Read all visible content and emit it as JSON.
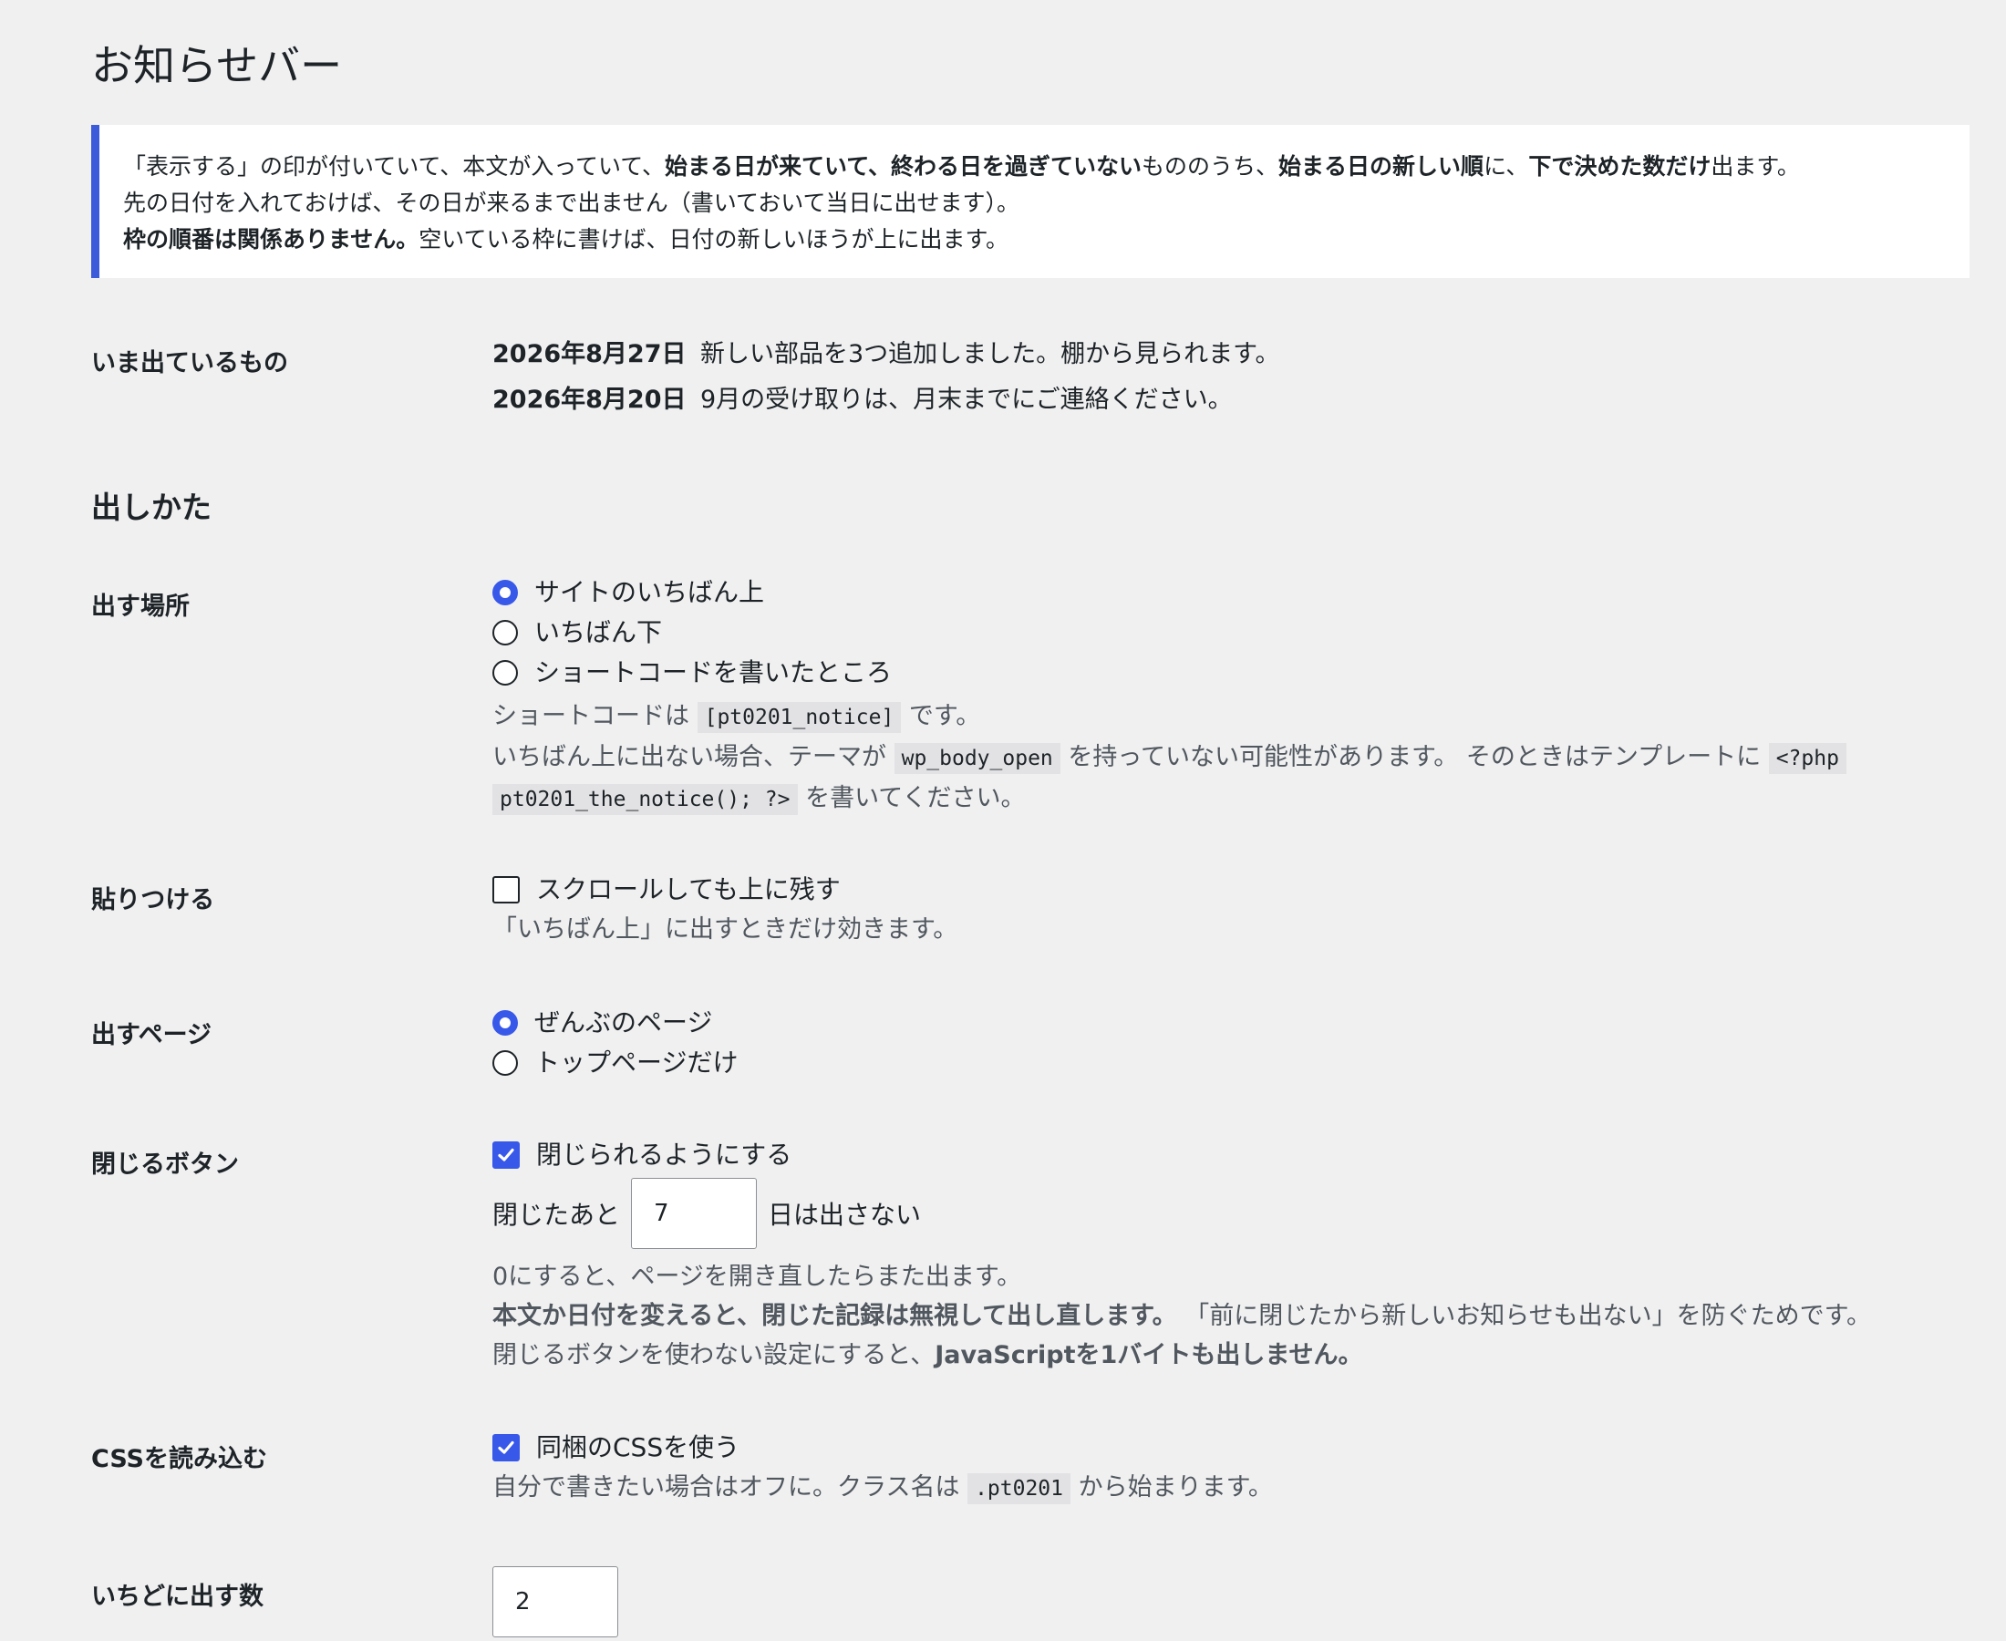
{
  "page": {
    "title": "お知らせバー"
  },
  "notice": {
    "l1_a": "「表示する」の印が付いていて、本文が入っていて、",
    "l1_b": "始まる日が来ていて、終わる日を過ぎていない",
    "l1_c": "もののうち、",
    "l1_d": "始まる日の新しい順",
    "l1_e": "に、",
    "l1_f": "下で決めた数だけ",
    "l1_g": "出ます。",
    "l2": "先の日付を入れておけば、その日が来るまで出ません（書いておいて当日に出せます）。",
    "l3_a": "枠の順番は関係ありません。",
    "l3_b": "空いている枠に書けば、日付の新しいほうが上に出ます。"
  },
  "current": {
    "label": "いま出ているもの",
    "items": [
      {
        "date": "2026年8月27日",
        "text": "新しい部品を3つ追加しました。棚から見られます。"
      },
      {
        "date": "2026年8月20日",
        "text": "9月の受け取りは、月末までにご連絡ください。"
      }
    ]
  },
  "section": {
    "heading": "出しかた"
  },
  "placement": {
    "label": "出す場所",
    "options": [
      "サイトのいちばん上",
      "いちばん下",
      "ショートコードを書いたところ"
    ],
    "selected_index": 0,
    "desc1_a": "ショートコードは",
    "desc1_code": "[pt0201_notice]",
    "desc1_b": "です。",
    "desc2_a": "いちばん上に出ない場合、テーマが",
    "desc2_code": "wp_body_open",
    "desc2_b": "を持っていない可能性があります。 そのときはテンプレートに",
    "desc2_code2a": "<?php",
    "desc3_code": "pt0201_the_notice(); ?>",
    "desc3_b": "を書いてください。"
  },
  "sticky": {
    "label": "貼りつける",
    "option": "スクロールしても上に残す",
    "checked": false,
    "desc": "「いちばん上」に出すときだけ効きます。"
  },
  "pages": {
    "label": "出すページ",
    "options": [
      "ぜんぶのページ",
      "トップページだけ"
    ],
    "selected_index": 0
  },
  "close": {
    "label": "閉じるボタン",
    "option": "閉じられるようにする",
    "checked": true,
    "days_prefix": "閉じたあと",
    "days_value": "7",
    "days_suffix": "日は出さない",
    "desc1": "0にすると、ページを開き直したらまた出ます。",
    "desc2_a": "本文か日付を変えると、閉じた記録は無視して出し直します。",
    "desc2_b": "「前に閉じたから新しいお知らせも出ない」を防ぐためです。",
    "desc3_a": "閉じるボタンを使わない設定にすると、",
    "desc3_b": "JavaScriptを1バイトも出しません。"
  },
  "css": {
    "label": "CSSを読み込む",
    "option": "同梱のCSSを使う",
    "checked": true,
    "desc_a": "自分で書きたい場合はオフに。クラス名は",
    "desc_code": ".pt0201",
    "desc_b": "から始まります。"
  },
  "count": {
    "label": "いちどに出す数",
    "value": "2"
  },
  "colors": {
    "accent": "#3858e9",
    "notice_border": "#3b5bdb",
    "background": "#f0f0f1"
  }
}
